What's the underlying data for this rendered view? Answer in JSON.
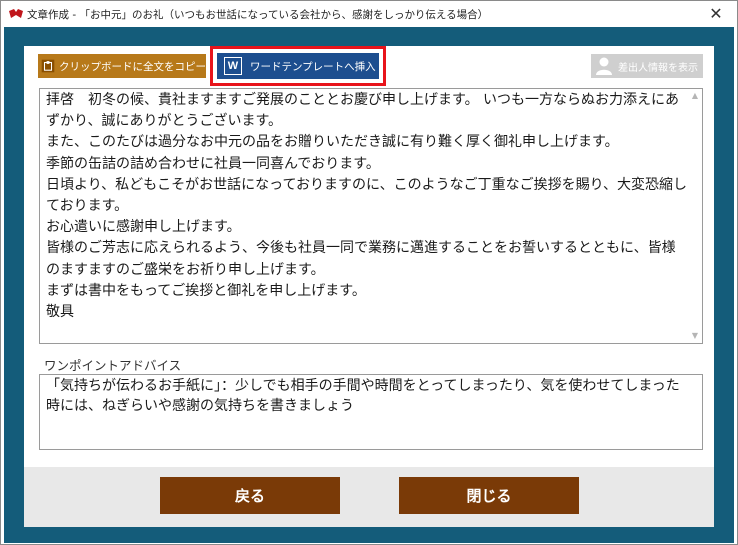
{
  "window": {
    "title": "文章作成 - 「お中元」のお礼（いつもお世話になっている会社から、感謝をしっかり伝える場合）",
    "close_glyph": "✕",
    "app_icon": "app-logo-icon"
  },
  "toolbar": {
    "copy_label": "クリップボードに全文をコピー",
    "copy_icon": "clipboard-icon",
    "word_label": "ワードテンプレートへ挿入",
    "word_icon_letter": "W",
    "sender_label": "差出人情報を表示",
    "sender_icon": "person-icon",
    "accent_copy": "#b7791a",
    "accent_word": "#1d4e8f",
    "highlight": "#e8141b"
  },
  "letter": {
    "lines": [
      "拝啓　初冬の候、貴社ますますご発展のこととお慶び申し上げます。 いつも一方ならぬお力添えにあずかり、誠にありがとうございます。",
      "また、このたびは過分なお中元の品をお贈りいただき誠に有り難く厚く御礼申し上げます。",
      "季節の缶詰の詰め合わせに社員一同喜んでおります。",
      "日頃より、私どもこそがお世話になっておりますのに、このようなご丁重なご挨拶を賜り、大変恐縮しております。",
      "お心遣いに感謝申し上げます。",
      "皆様のご芳志に応えられるよう、今後も社員一同で業務に邁進することをお誓いするとともに、皆様のますますのご盛栄をお祈り申し上げます。",
      "まずは書中をもってご挨拶と御礼を申し上げます。",
      "敬具"
    ]
  },
  "advice": {
    "label": "ワンポイントアドバイス",
    "text": "「気持ちが伝わるお手紙に」：少しでも相手の手間や時間をとってしまったり、気を使わせてしまった時には、ねぎらいや感謝の気持ちを書きましょう"
  },
  "footer": {
    "back_label": "戻る",
    "close_label": "閉じる",
    "button_color": "#7a3a07"
  },
  "frame_color": "#145c7a"
}
